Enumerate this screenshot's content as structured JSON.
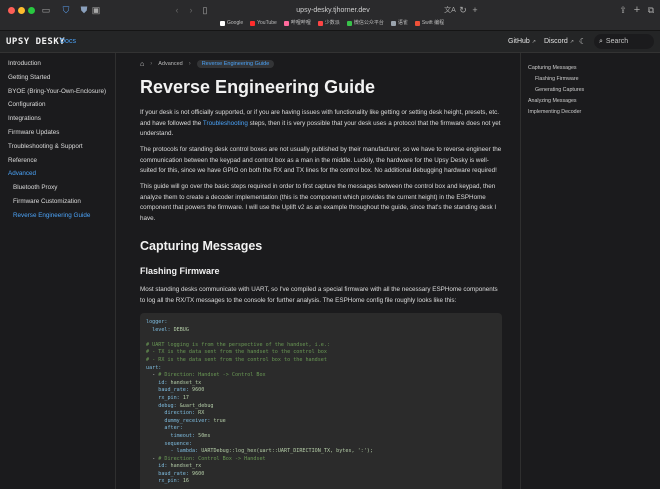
{
  "browser": {
    "url": "upsy-desky.tjhorner.dev",
    "bookmarks": [
      {
        "label": "Google",
        "color": "#ffffff"
      },
      {
        "label": "YouTube",
        "color": "#ff2d2d"
      },
      {
        "label": "哔哩哔哩",
        "color": "#ff6a9c"
      },
      {
        "label": "少数派",
        "color": "#ff4545"
      },
      {
        "label": "微信公众平台",
        "color": "#38c24a"
      },
      {
        "label": "语雀",
        "color": "#9aa3ad"
      },
      {
        "label": "Swift 编程",
        "color": "#f05138"
      }
    ]
  },
  "navbar": {
    "logo": "UPSY DESKY",
    "docs": "Docs",
    "github": "GitHub",
    "discord": "Discord",
    "search": "Search"
  },
  "sidebar": {
    "items": [
      {
        "label": "Introduction"
      },
      {
        "label": "Getting Started"
      },
      {
        "label": "BYOE (Bring-Your-Own-Enclosure)"
      },
      {
        "label": "Configuration"
      },
      {
        "label": "Integrations"
      },
      {
        "label": "Firmware Updates"
      },
      {
        "label": "Troubleshooting & Support"
      },
      {
        "label": "Reference"
      },
      {
        "label": "Advanced"
      }
    ],
    "sub_items": [
      {
        "label": "Bluetooth Proxy"
      },
      {
        "label": "Firmware Customization"
      },
      {
        "label": "Reverse Engineering Guide"
      }
    ]
  },
  "breadcrumb": {
    "parent": "Advanced",
    "current": "Reverse Engineering Guide"
  },
  "page": {
    "title": "Reverse Engineering Guide",
    "p1_before": "If your desk is not officially supported, or if you are having issues with functionality like getting or setting desk height, presets, etc. and have followed the ",
    "p1_link": "Troubleshooting",
    "p1_after": " steps, then it is very possible that your desk uses a protocol that the firmware does not yet understand.",
    "p2": "The protocols for standing desk control boxes are not usually published by their manufacturer, so we have to reverse engineer the communication between the keypad and control box as a man in the middle. Luckily, the hardware for the Upsy Desky is well-suited for this, since we have GPIO on both the RX and TX lines for the control box. No additional debugging hardware required!",
    "p3": "This guide will go over the basic steps required in order to first capture the messages between the control box and keypad, then analyze them to create a decoder implementation (this is the component which provides the current height) in the ESPHome component that powers the firmware. I will use the Uplift v2 as an example throughout the guide, since that's the standing desk I have.",
    "h2": "Capturing Messages",
    "h3": "Flashing Firmware",
    "p4": "Most standing desks communicate with UART, so I've compiled a special firmware with all the necessary ESPHome components to log all the RX/TX messages to the console for further analysis. The ESPHome config file roughly looks like this:"
  },
  "code_lines": [
    [
      {
        "t": "logger:",
        "c": "k"
      }
    ],
    [
      {
        "t": "  level: ",
        "c": "k"
      },
      {
        "t": "DEBUG",
        "c": "v"
      }
    ],
    [
      {
        "t": "",
        "c": "p"
      }
    ],
    [
      {
        "t": "# UART logging is from the perspective of the handset, i.e.:",
        "c": "c"
      }
    ],
    [
      {
        "t": "# - TX is the data sent from the handset to the control box",
        "c": "c"
      }
    ],
    [
      {
        "t": "# - RX is the data sent from the control box to the handset",
        "c": "c"
      }
    ],
    [
      {
        "t": "uart:",
        "c": "k"
      }
    ],
    [
      {
        "t": "  - ",
        "c": "p"
      },
      {
        "t": "# Direction: Handset -> Control Box",
        "c": "c"
      }
    ],
    [
      {
        "t": "    id: ",
        "c": "k"
      },
      {
        "t": "handset_tx",
        "c": "v"
      }
    ],
    [
      {
        "t": "    baud_rate: ",
        "c": "k"
      },
      {
        "t": "9600",
        "c": "v"
      }
    ],
    [
      {
        "t": "    rx_pin: ",
        "c": "k"
      },
      {
        "t": "17",
        "c": "v"
      }
    ],
    [
      {
        "t": "    debug: ",
        "c": "k"
      },
      {
        "t": "&uart_debug",
        "c": "v"
      }
    ],
    [
      {
        "t": "      direction: ",
        "c": "k"
      },
      {
        "t": "RX",
        "c": "v"
      }
    ],
    [
      {
        "t": "      dummy_receiver: ",
        "c": "k"
      },
      {
        "t": "true",
        "c": "v"
      }
    ],
    [
      {
        "t": "      after:",
        "c": "k"
      }
    ],
    [
      {
        "t": "        timeout: ",
        "c": "k"
      },
      {
        "t": "50ms",
        "c": "v"
      }
    ],
    [
      {
        "t": "      sequence:",
        "c": "k"
      }
    ],
    [
      {
        "t": "        - lambda: ",
        "c": "k"
      },
      {
        "t": "UARTDebug::log_hex(uart::UART_DIRECTION_TX, bytes, ':');",
        "c": "v"
      }
    ],
    [
      {
        "t": "  - ",
        "c": "p"
      },
      {
        "t": "# Direction: Control Box -> Handset",
        "c": "c"
      }
    ],
    [
      {
        "t": "    id: ",
        "c": "k"
      },
      {
        "t": "handset_rx",
        "c": "v"
      }
    ],
    [
      {
        "t": "    baud_rate: ",
        "c": "k"
      },
      {
        "t": "9600",
        "c": "v"
      }
    ],
    [
      {
        "t": "    rx_pin: ",
        "c": "k"
      },
      {
        "t": "16",
        "c": "v"
      }
    ]
  ],
  "toc": [
    {
      "label": "Capturing Messages",
      "level": 1
    },
    {
      "label": "Flashing Firmware",
      "level": 2
    },
    {
      "label": "Generating Captures",
      "level": 2
    },
    {
      "label": "Analyzing Messages",
      "level": 1
    },
    {
      "label": "Implementing Decoder",
      "level": 1
    }
  ]
}
